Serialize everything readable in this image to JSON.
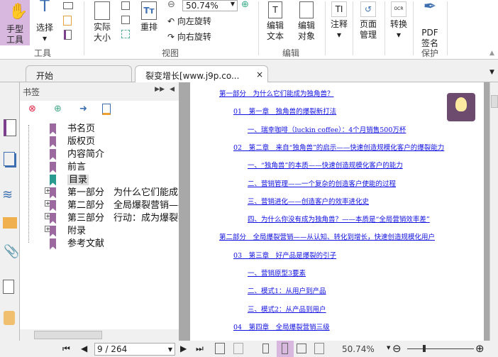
{
  "ribbon": {
    "hand_tool": "手型\n工具",
    "select": "选择",
    "actual_size": "实际\n大小",
    "reflow": "重排",
    "zoom_value": "50.74%",
    "rotate_left": "向左旋转",
    "rotate_right": "向右旋转",
    "edit_text": "编辑\n文本",
    "edit_object": "编辑\n对象",
    "annotate": "注释",
    "page_manage": "页面\n管理",
    "convert": "转换",
    "pdf_sign": "PDF\n签名",
    "groups": {
      "tools": "工具",
      "view": "视图",
      "edit": "编辑",
      "protect": "保护"
    }
  },
  "tabs": [
    {
      "label": "开始"
    },
    {
      "label": "裂变增长[www.j9p.co..."
    }
  ],
  "bookmarks": {
    "title": "书签",
    "items": [
      {
        "label": "书名页",
        "expandable": false
      },
      {
        "label": "版权页",
        "expandable": false
      },
      {
        "label": "内容简介",
        "expandable": false
      },
      {
        "label": "前言",
        "expandable": false
      },
      {
        "label": "目录",
        "expandable": false,
        "selected": true
      },
      {
        "label": "第一部分　为什么它们能成为独角",
        "expandable": true
      },
      {
        "label": "第二部分　全局爆裂营销——从认",
        "expandable": true
      },
      {
        "label": "第三部分　行动：成为爆裂独角兽",
        "expandable": true
      },
      {
        "label": "附录",
        "expandable": true
      },
      {
        "label": "参考文献",
        "expandable": false
      }
    ]
  },
  "toc": [
    {
      "text": "第一部分　为什么它们能成为独角兽？",
      "level": 0
    },
    {
      "text": "01　第一章　独角兽的爆裂新打法",
      "level": 1
    },
    {
      "text": "一、瑞幸咖啡（luckin coffee）：4个月销售500万杯",
      "level": 2
    },
    {
      "text": "02　第二章　来自“独角兽”的启示——快速创造规模化客户的爆裂能力",
      "level": 1
    },
    {
      "text": "一、“独角兽”的本质——快速创造规模化客户的能力",
      "level": 2
    },
    {
      "text": "二、营销管理——一个复杂的创造客户使能的过程",
      "level": 2
    },
    {
      "text": "三、营销进化——创造客户的效率进化史",
      "level": 2
    },
    {
      "text": "四、为什么你没有成为独角兽？——本质是“全局营销效率差”",
      "level": 2
    },
    {
      "text": "第二部分　全局爆裂营销——从认知、转化到增长，快速创造规模化用户",
      "level": 0
    },
    {
      "text": "03　第三章　好产品是爆裂的引子",
      "level": 1
    },
    {
      "text": "一、营销原型3要素",
      "level": 2
    },
    {
      "text": "二、模式1：从用户到产品",
      "level": 2
    },
    {
      "text": "三、模式2：从产品到用户",
      "level": 2
    },
    {
      "text": "04　第四章　全局爆裂营销三级",
      "level": 1
    }
  ],
  "status": {
    "page": "9 / 264",
    "zoom": "50.74%",
    "zoom_slider_fraction": 0.25
  },
  "colors": {
    "accent": "#9b69a0",
    "link": "#1010e0",
    "active_tool": "#d9b8e0"
  }
}
